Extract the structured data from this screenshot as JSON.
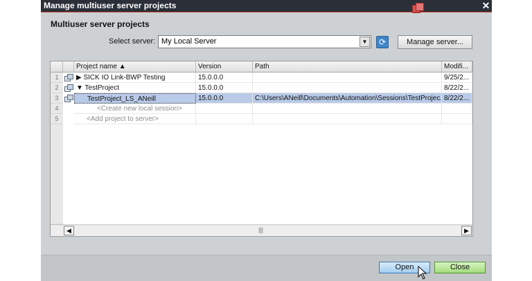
{
  "window": {
    "title": "Manage multiuser server projects",
    "close_glyph": "✕"
  },
  "section": {
    "heading": "Multiuser server projects"
  },
  "server": {
    "label": "Select server:",
    "value": "My Local Server"
  },
  "buttons": {
    "manage": "Manage server...",
    "open": "Open",
    "close": "Close"
  },
  "table": {
    "columns": [
      "Project name ▲",
      "Version",
      "Path",
      "Modifi..."
    ],
    "rows": [
      {
        "num": "1",
        "name": "SICK IO Link-BWP Testing",
        "expand": "▶",
        "version": "15.0.0.0",
        "path": "",
        "modified": "9/25/2..."
      },
      {
        "num": "2",
        "name": "TestProject",
        "expand": "▼",
        "version": "15.0.0.0",
        "path": "",
        "modified": "8/22/2..."
      },
      {
        "num": "3",
        "name": "TestProject_LS_ANeill",
        "expand": "",
        "version": "15.0.0.0",
        "path": "C:\\Users\\ANeill\\Documents\\Automation\\Sessions\\TestProjec...",
        "modified": "8/22/2..."
      },
      {
        "num": "4",
        "name": "<Create new local session>",
        "expand": "",
        "version": "",
        "path": "",
        "modified": ""
      },
      {
        "num": "5",
        "name": "<Add project to server>",
        "expand": "",
        "version": "",
        "path": "",
        "modified": ""
      }
    ]
  },
  "colors": {
    "titlebar": "#2a2f38",
    "dialog": "#ced1d4",
    "selection": "#b9cbe8",
    "open_button": "#a3cdef",
    "close_button": "#a2dc7c"
  },
  "icons": [
    "red-app-icon",
    "refresh-icon",
    "dropdown-arrow-icon",
    "project-icon",
    "expand-icon",
    "collapse-icon",
    "scroll-left-icon",
    "scroll-right-icon",
    "mouse-cursor-icon"
  ]
}
